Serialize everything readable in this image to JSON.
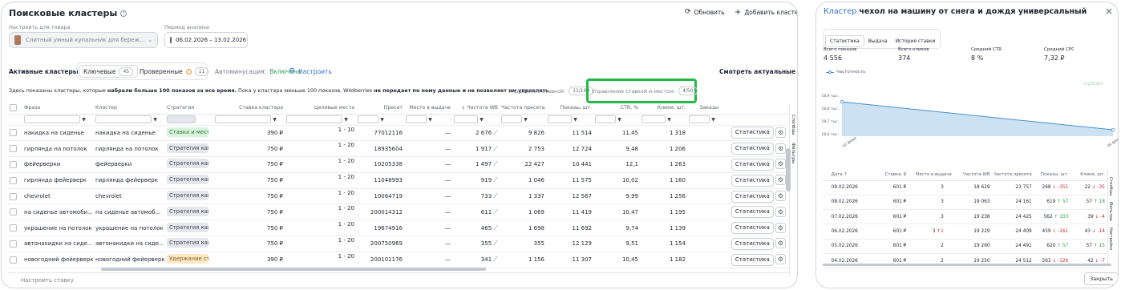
{
  "left": {
    "title": "Поисковые кластеры",
    "refresh_label": "Обновить",
    "add_label": "Добавить кластеры",
    "product_label": "Настроить для товара",
    "product_value": "Слитный умный купальник для бережного з...",
    "period_label": "Период анализа",
    "period_value": "06.02.2026 – 13.02.2026",
    "active_label": "Активные кластеры",
    "tab_keys_label": "Ключевые",
    "tab_keys_count": "45",
    "tab_checked_label": "Проверенные",
    "tab_checked_count": "11",
    "automin_label": "Автоминусация:",
    "automin_value": "Включена",
    "configure_label": "Настроить",
    "actual_bids_label": "Смотреть актуальные ставки",
    "notice_prefix": "Здесь показаны кластеры, которые",
    "notice_bold1": "набрали больше 100 показов за все время.",
    "notice_mid": "Пока у кластера меньше 100 показов, Wildberries",
    "notice_bold2": "не передает по нему данные и не позволяет им управлять",
    "bid_mgmt_label": "Управление ставкой:",
    "bid_mgmt_count": "11/100",
    "bid_place_label": "Управление ставкой и местом:",
    "bid_place_count": "4/50",
    "columns": [
      "Фраза",
      "Кластер",
      "Стратегия",
      "Ставка кластера",
      "Целевые места",
      "Пресет",
      "Место в выдаче",
      "Частота WB",
      "Частота пресета",
      "Показы, шт.",
      "CTR, %",
      "Клики, шт.",
      "Заказы"
    ],
    "rows": [
      {
        "phrase": "накидка на сиденье",
        "cluster": "накидка на сиденье",
        "strategy": "Ставка и место",
        "strategy_color": "green",
        "bid": "390 ₽",
        "target": "1 - 10",
        "preset": "77012116",
        "place": "—",
        "freq": "2 676",
        "preset_freq": "9 826",
        "shows": "11 514",
        "ctr": "11,45",
        "clicks": "1 318"
      },
      {
        "phrase": "гирлянда на потолок",
        "cluster": "гирлянда на потолок",
        "strategy": "Стратегия камп",
        "strategy_color": "gray",
        "bid": "750 ₽",
        "target": "1 - 20",
        "preset": "18935604",
        "place": "—",
        "freq": "1 917",
        "preset_freq": "2 753",
        "shows": "12 724",
        "ctr": "9,48",
        "clicks": "1 206"
      },
      {
        "phrase": "фейерверки",
        "cluster": "фейерверки",
        "strategy": "Стратегия камп",
        "strategy_color": "gray",
        "bid": "750 ₽",
        "target": "1 - 20",
        "preset": "10205338",
        "place": "—",
        "freq": "1 497",
        "preset_freq": "22 427",
        "shows": "10 441",
        "ctr": "12,1",
        "clicks": "1 263"
      },
      {
        "phrase": "гирлянда фейерверк",
        "cluster": "гирлянда фейерверк",
        "strategy": "Стратегия камп",
        "strategy_color": "gray",
        "bid": "750 ₽",
        "target": "1 - 20",
        "preset": "11048993",
        "place": "—",
        "freq": "919",
        "preset_freq": "1 046",
        "shows": "11 575",
        "ctr": "10,02",
        "clicks": "1 160"
      },
      {
        "phrase": "chevrolet",
        "cluster": "chevrolet",
        "strategy": "Стратегия камп",
        "strategy_color": "gray",
        "bid": "750 ₽",
        "target": "1 - 20",
        "preset": "10064719",
        "place": "—",
        "freq": "733",
        "preset_freq": "1 337",
        "shows": "12 567",
        "ctr": "9,99",
        "clicks": "1 256"
      },
      {
        "phrase": "на сиденье автомоби...",
        "cluster": "на сиденье автомоб...",
        "strategy": "Стратегия камп",
        "strategy_color": "gray",
        "bid": "750 ₽",
        "target": "1 - 20",
        "preset": "200014312",
        "place": "—",
        "freq": "611",
        "preset_freq": "1 069",
        "shows": "11 419",
        "ctr": "10,47",
        "clicks": "1 195"
      },
      {
        "phrase": "украшение на потолок",
        "cluster": "украшение на потолок",
        "strategy": "Стратегия камп",
        "strategy_color": "gray",
        "bid": "750 ₽",
        "target": "1 - 20",
        "preset": "19674916",
        "place": "—",
        "freq": "465",
        "preset_freq": "1 698",
        "shows": "11 692",
        "ctr": "9,74",
        "clicks": "1 139"
      },
      {
        "phrase": "автонакидки на сиде...",
        "cluster": "автонакидки на сиде...",
        "strategy": "Стратегия камп",
        "strategy_color": "gray",
        "bid": "750 ₽",
        "target": "1 - 20",
        "preset": "200750969",
        "place": "—",
        "freq": "355",
        "preset_freq": "355",
        "shows": "12 129",
        "ctr": "9,51",
        "clicks": "1 154"
      },
      {
        "phrase": "новогодний фейерверк",
        "cluster": "новогодний фейерверк",
        "strategy": "Удержание ста",
        "strategy_color": "orange",
        "bid": "390 ₽",
        "target": "1 - 20",
        "preset": "200101176",
        "place": "—",
        "freq": "341",
        "preset_freq": "1 156",
        "shows": "11 307",
        "ctr": "10,45",
        "clicks": "1 182"
      }
    ],
    "stat_label": "Статистика",
    "side_tab1": "Столбцы",
    "side_tab2": "Фильтры",
    "bottom_label": "Настроить ставку"
  },
  "right": {
    "title_prefix": "Кластер",
    "title_name": "чехол на машину от снега и дождя универсальный",
    "tabs": [
      "Статистика",
      "Выдача",
      "История ставки"
    ],
    "kpis": [
      {
        "label": "Всего показов",
        "value": "4 556"
      },
      {
        "label": "Всего кликов",
        "value": "374"
      },
      {
        "label": "Средний CTR",
        "value": "8 %"
      },
      {
        "label": "Средний CPC",
        "value": "7,32 ₽"
      }
    ],
    "legend": "Частотность",
    "watermark": "mpstats",
    "columns": [
      "Дата",
      "Ставка, ₽",
      "Место в выдаче",
      "Частота WB",
      "Частота пресета",
      "Показы, шт.",
      "Клики, шт."
    ],
    "rows": [
      {
        "date": "09.02.2026",
        "bid": "601 ₽",
        "place": "3",
        "place_delta": "",
        "freq": "18 629",
        "preset": "23 757",
        "shows": "268",
        "shows_delta": "-351",
        "shows_dir": "down",
        "clicks": "22",
        "clicks_delta": "-35",
        "clicks_dir": "down"
      },
      {
        "date": "08.02.2026",
        "bid": "601 ₽",
        "place": "3",
        "place_delta": "",
        "freq": "19 063",
        "preset": "24 161",
        "shows": "619",
        "shows_delta": "57",
        "shows_dir": "up",
        "clicks": "57",
        "clicks_delta": "18",
        "clicks_dir": "up"
      },
      {
        "date": "07.02.2026",
        "bid": "601 ₽",
        "place": "3",
        "place_delta": "",
        "freq": "19 238",
        "preset": "24 425",
        "shows": "562",
        "shows_delta": "103",
        "shows_dir": "up",
        "clicks": "39",
        "clicks_delta": "-4",
        "clicks_dir": "down"
      },
      {
        "date": "06.02.2026",
        "bid": "601 ₽",
        "place": "3",
        "place_delta": "1",
        "freq": "19 229",
        "preset": "24 409",
        "shows": "459",
        "shows_delta": "-161",
        "shows_dir": "down",
        "clicks": "43",
        "clicks_delta": "-14",
        "clicks_dir": "down"
      },
      {
        "date": "05.02.2026",
        "bid": "601 ₽",
        "place": "2",
        "place_delta": "",
        "freq": "19 260",
        "preset": "24 491",
        "shows": "620",
        "shows_delta": "57",
        "shows_dir": "up",
        "clicks": "57",
        "clicks_delta": "15",
        "clicks_dir": "up"
      },
      {
        "date": "04.02.2026",
        "bid": "601 ₽",
        "place": "2",
        "place_delta": "",
        "freq": "19 250",
        "preset": "24 512",
        "shows": "563",
        "shows_delta": "-126",
        "shows_dir": "down",
        "clicks": "42",
        "clicks_delta": "-7",
        "clicks_dir": "down"
      }
    ],
    "side_tab1": "Столбцы",
    "side_tab2": "Фильтры",
    "side_tab3": "Настройки",
    "close_label": "Закрыть"
  },
  "chart_data": {
    "type": "area",
    "series": [
      {
        "name": "Частотность",
        "values": [
          18.85,
          18.63
        ]
      }
    ],
    "x": [
      "02 февр.",
      "09 февр."
    ],
    "y_ticks": [
      "18,9 тыс.",
      "18,8 тыс.",
      "18,7 тыс.",
      "18,6 тыс."
    ],
    "ylim": [
      18.58,
      18.92
    ],
    "color": "#4a90c8"
  }
}
